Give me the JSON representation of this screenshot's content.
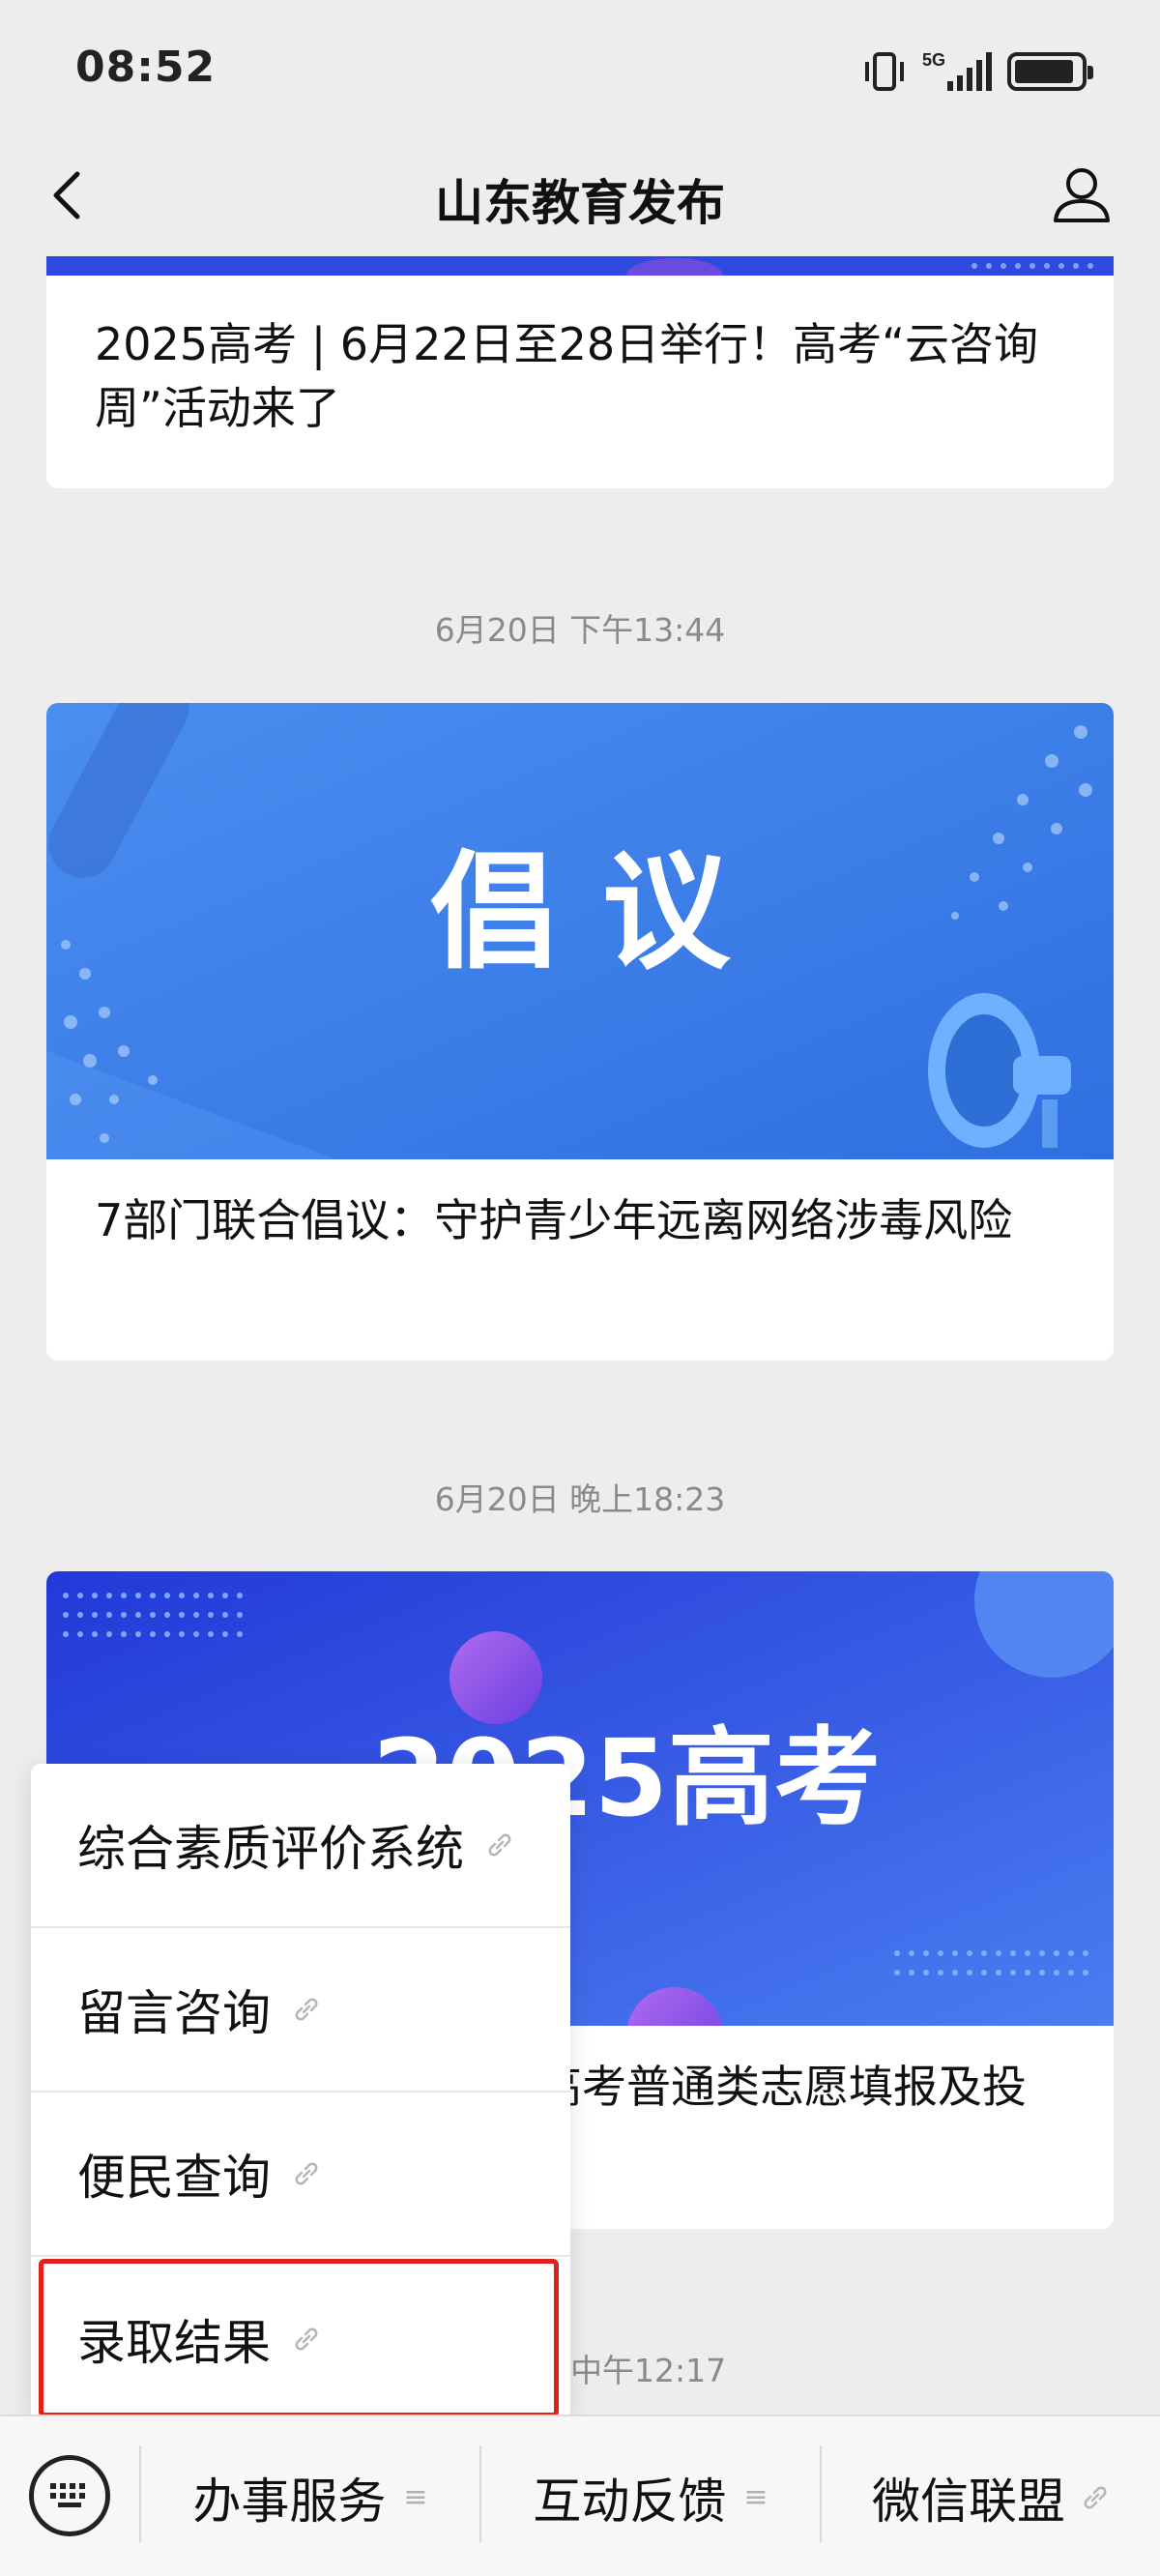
{
  "status_bar": {
    "time": "08:52",
    "network": "5G",
    "icons": [
      "vibrate-icon",
      "signal-5g-icon",
      "battery-icon"
    ]
  },
  "nav": {
    "title": "山东教育发布",
    "back_icon": "chevron-left-icon",
    "profile_icon": "person-icon"
  },
  "articles": [
    {
      "title": "2025高考 | 6月22日至28日举行！高考“云咨询周”活动来了"
    },
    {
      "timestamp": "6月20日 下午13:44",
      "banner_text": "倡 议",
      "title": "7部门联合倡议：守护青少年远离网络涉毒风险"
    },
    {
      "timestamp": "6月20日 晚上18:23",
      "banner_text": "2025高考",
      "title_visible": "高考普通类志愿填报及投"
    },
    {
      "timestamp_partial": "中午12:17"
    }
  ],
  "popup_menu": {
    "items": [
      {
        "label": "综合素质评价系统",
        "icon": "link-icon"
      },
      {
        "label": "留言咨询",
        "icon": "link-icon"
      },
      {
        "label": "便民查询",
        "icon": "link-icon"
      },
      {
        "label": "录取结果",
        "icon": "link-icon",
        "highlighted": true
      }
    ]
  },
  "bottom_menu": {
    "keyboard_icon": "keyboard-icon",
    "tabs": [
      {
        "label": "办事服务",
        "icon": "hamburger-icon"
      },
      {
        "label": "互动反馈",
        "icon": "hamburger-icon"
      },
      {
        "label": "微信联盟",
        "icon": "link-icon"
      }
    ]
  },
  "colors": {
    "background": "#ededed",
    "highlight": "#e0201b",
    "banner_blue": "#3f7de0",
    "banner_deep_blue": "#2f49e0"
  }
}
